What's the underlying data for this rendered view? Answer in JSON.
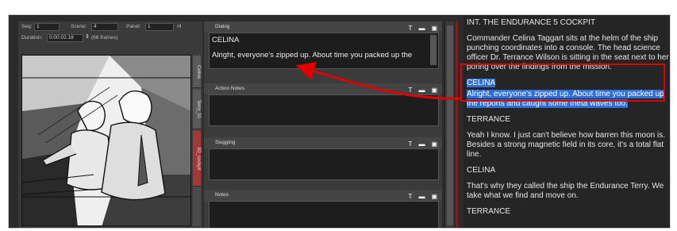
{
  "header": {
    "seq_label": "Seq:",
    "seq_value": "1",
    "scene_label": "Scene:",
    "scene_value": "4",
    "panel_label": "Panel:",
    "panel_value": "1",
    "panel_total": "/4",
    "duration_label": "Duration:",
    "duration_value": "0:00:02.18",
    "frames_count": "(66 frames)"
  },
  "side_tabs": [
    "Celina",
    "Terry_01",
    "3D_cockpit"
  ],
  "panels": {
    "dialog": {
      "title": "Dialog",
      "character": "CELINA",
      "line": "Alright, everyone's zipped up. About time you packed up the"
    },
    "action_notes": {
      "title": "Action Notes"
    },
    "slugging": {
      "title": "Slugging"
    },
    "notes": {
      "title": "Notes"
    }
  },
  "panel_icons": [
    "text-tool-icon",
    "open-icon",
    "export-icon"
  ],
  "script": {
    "heading": "INT. THE ENDURANCE 5 COCKPIT",
    "action1": "Commander Celina Taggart sits at the helm of the ship punching coordinates into a console. The head science officer Dr. Terrance Wilson is sitting in the seat next to her poring over the findings from the mission.",
    "char1": "CELINA",
    "dialog1": "Alright, everyone's zipped up. About time you packed up the reports and caught some theta waves too.",
    "char2": "TERRANCE",
    "dialog2": "Yeah I know. I just can't believe how barren this moon is. Besides a strong magnetic field in its core, it's a total flat line.",
    "char3": "CELINA",
    "dialog3": "That's why they called the ship the Endurance Terry. We take what we find and move on.",
    "char4": "TERRANCE"
  },
  "colors": {
    "highlight": "#2f6fd6",
    "annotation_red": "#e00000"
  }
}
